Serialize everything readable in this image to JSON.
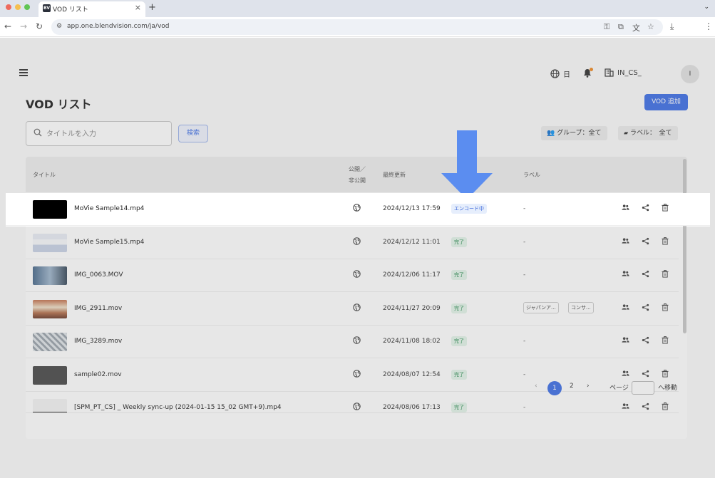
{
  "browser": {
    "tab_title": "VOD リスト",
    "tab_favicon": "BV",
    "url": "app.one.blendvision.com/ja/vod",
    "traffic_colors": [
      "#ee6a5e",
      "#f5bf4f",
      "#61c554"
    ]
  },
  "header": {
    "language": "日",
    "org": "IN_CS_",
    "avatar": "I"
  },
  "page": {
    "title": "VOD リスト",
    "add_button": "VOD 追加",
    "search_placeholder": "タイトルを入力",
    "search_button": "検索",
    "filter_group": "グループ：全て",
    "filter_label": "ラベル：　全て"
  },
  "table": {
    "headers": {
      "title": "タイトル",
      "public": "公開／",
      "public2": "非公開",
      "updated": "最終更新",
      "label": "ラベル"
    },
    "rows": [
      {
        "title": "MoVie Sample14.mp4",
        "updated": "2024/12/13 17:59",
        "status": "エンコード中",
        "label": "-"
      },
      {
        "title": "MoVie Sample15.mp4",
        "updated": "2024/12/12 11:01",
        "status": "完了",
        "label": "-"
      },
      {
        "title": "IMG_0063.MOV",
        "updated": "2024/12/06 11:17",
        "status": "完了",
        "label": "-"
      },
      {
        "title": "IMG_2911.mov",
        "updated": "2024/11/27 20:09",
        "status": "完了",
        "labels": [
          "ジャパンア...",
          "コンサ..."
        ]
      },
      {
        "title": "IMG_3289.mov",
        "updated": "2024/11/08 18:02",
        "status": "完了",
        "label": "-"
      },
      {
        "title": "sample02.mov",
        "updated": "2024/08/07 12:54",
        "status": "完了",
        "label": "-"
      },
      {
        "title": "[SPM_PT_CS] _ Weekly sync-up (2024-01-15 15_02 GMT+9).mp4",
        "updated": "2024/08/06 17:13",
        "status": "完了",
        "label": "-"
      }
    ]
  },
  "pagination": {
    "prev": "‹",
    "page1": "1",
    "page2": "2",
    "next": "›",
    "page_label": "ページ",
    "goto_label": "へ移動"
  },
  "colors": {
    "accent": "#3f6fe6",
    "arrow": "#5b8df0",
    "done_bg": "#e3f5ea",
    "encoding_bg": "#e6eefc"
  }
}
